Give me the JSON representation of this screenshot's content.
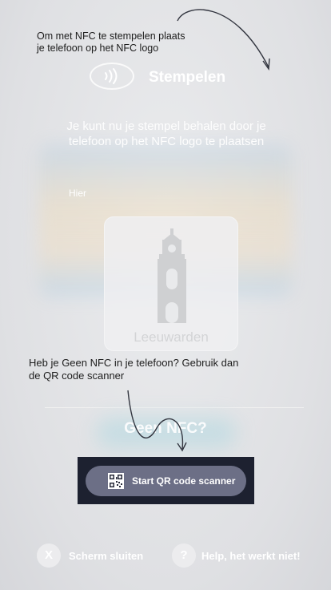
{
  "hints": {
    "top": "Om met NFC te stempelen plaats\nje telefoon op het NFC logo",
    "middle": "Heb je Geen NFC in je telefoon? Gebruik dan\nde QR code scanner",
    "hier": "Hier"
  },
  "header": {
    "title": "Stempelen"
  },
  "instruction": "Je kunt nu je stempel behalen door je telefoon op het NFC logo te plaatsen",
  "stamp_card": {
    "city": "Leeuwarden"
  },
  "no_nfc": {
    "heading": "Geen NFC?",
    "button_label": "Start QR code scanner"
  },
  "footer": {
    "close_icon_glyph": "X",
    "close_label": "Scherm sluiten",
    "help_icon_glyph": "?",
    "help_label": "Help, het werkt niet!"
  },
  "colors": {
    "overlay": "#e3e4e6",
    "button": "#6c6f86",
    "highlight_box": "#1d2130"
  }
}
